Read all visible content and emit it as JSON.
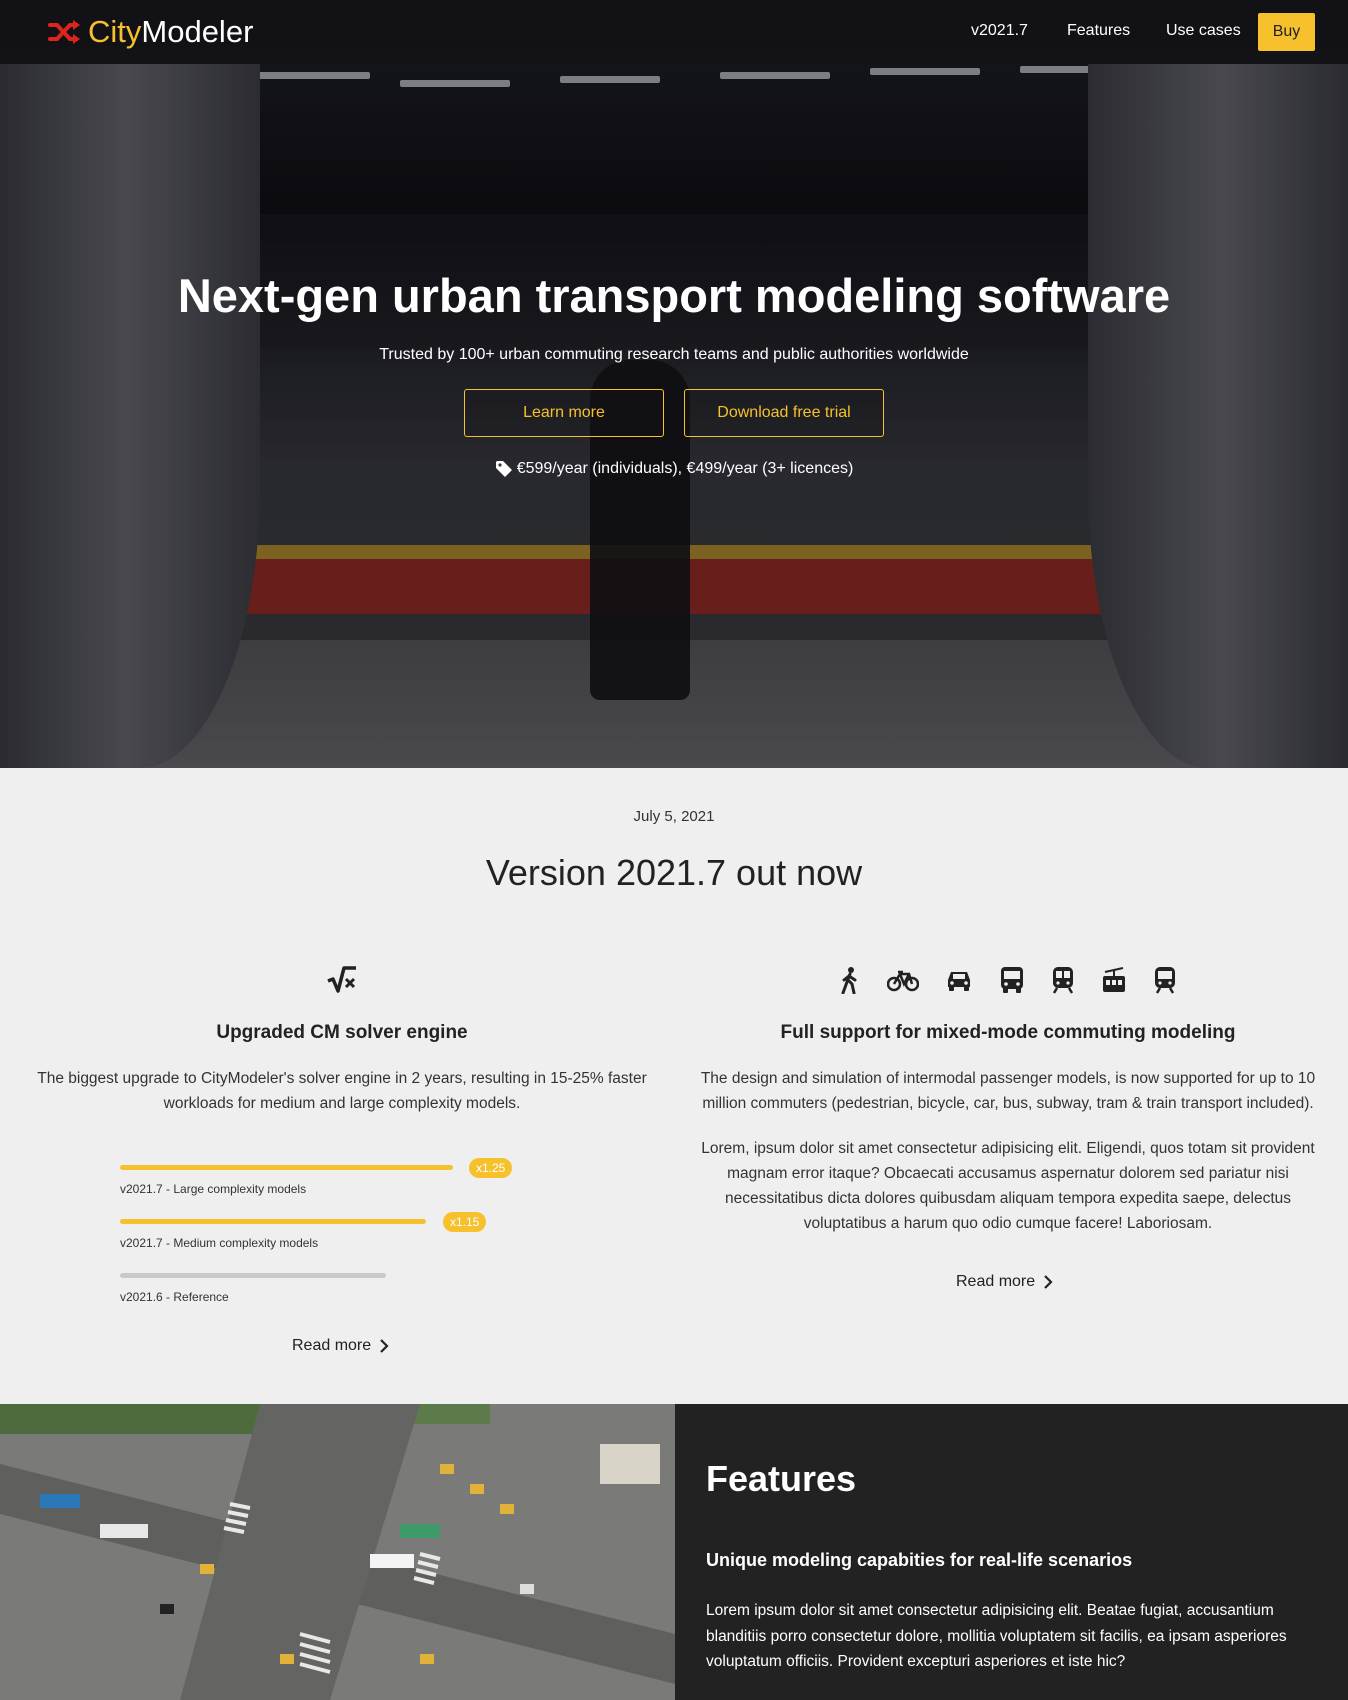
{
  "nav": {
    "brand_city": "City",
    "brand_modeler": "Modeler",
    "version_link": "v2021.7",
    "features_link": "Features",
    "use_cases_link": "Use cases",
    "buy_label": "Buy"
  },
  "hero": {
    "title": "Next-gen urban transport modeling software",
    "subtitle": "Trusted by 100+ urban commuting research teams and public authorities worldwide",
    "learn_more": "Learn more",
    "download_trial": "Download free trial",
    "pricing": "€599/year (individuals), €499/year (3+ licences)"
  },
  "news": {
    "date": "July 5, 2021",
    "title": "Version 2021.7 out now",
    "solver": {
      "icon": "square-root-icon",
      "title": "Upgraded CM solver engine",
      "text": "The biggest upgrade to CityModeler's solver engine in 2 years, resulting in 15-25% faster workloads for medium and large complexity models.",
      "bars": [
        {
          "label": "v2021.7 - Large complexity models",
          "badge": "x1.25",
          "value": 1.25,
          "color": "#f6c12d"
        },
        {
          "label": "v2021.7 - Medium complexity models",
          "badge": "x1.15",
          "value": 1.15,
          "color": "#f6c12d"
        },
        {
          "label": "v2021.6 - Reference",
          "badge": "",
          "value": 1.0,
          "color": "#c9c9c9"
        }
      ],
      "read_more": "Read more"
    },
    "mixed_mode": {
      "icons": [
        "pedestrian-icon",
        "bicycle-icon",
        "car-icon",
        "bus-icon",
        "subway-icon",
        "tram-icon",
        "train-icon"
      ],
      "title": "Full support for mixed-mode commuting modeling",
      "text": "The design and simulation of intermodal passenger models, is now supported for up to 10 million commuters (pedestrian, bicycle, car, bus, subway, tram & train transport included).",
      "text2": "Lorem, ipsum dolor sit amet consectetur adipisicing elit. Eligendi, quos totam sit provident magnam error itaque? Obcaecati accusamus aspernatur dolorem sed pariatur nisi necessitatibus dicta dolores quibusdam aliquam tempora expedita saepe, delectus voluptatibus a harum quo odio cumque facere! Laboriosam.",
      "read_more": "Read more"
    }
  },
  "features": {
    "title": "Features",
    "subtitle": "Unique modeling capabities for real-life scenarios",
    "text": "Lorem ipsum dolor sit amet consectetur adipisicing elit. Beatae fugiat, accusantium blanditiis porro consectetur dolore, mollitia voluptatem sit facilis, ea ipsam asperiores voluptatum officiis. Provident excepturi asperiores et iste hic?"
  },
  "colors": {
    "accent": "#f6c12d",
    "brand_icon": "#e0241b",
    "dark_panel": "#222222"
  }
}
